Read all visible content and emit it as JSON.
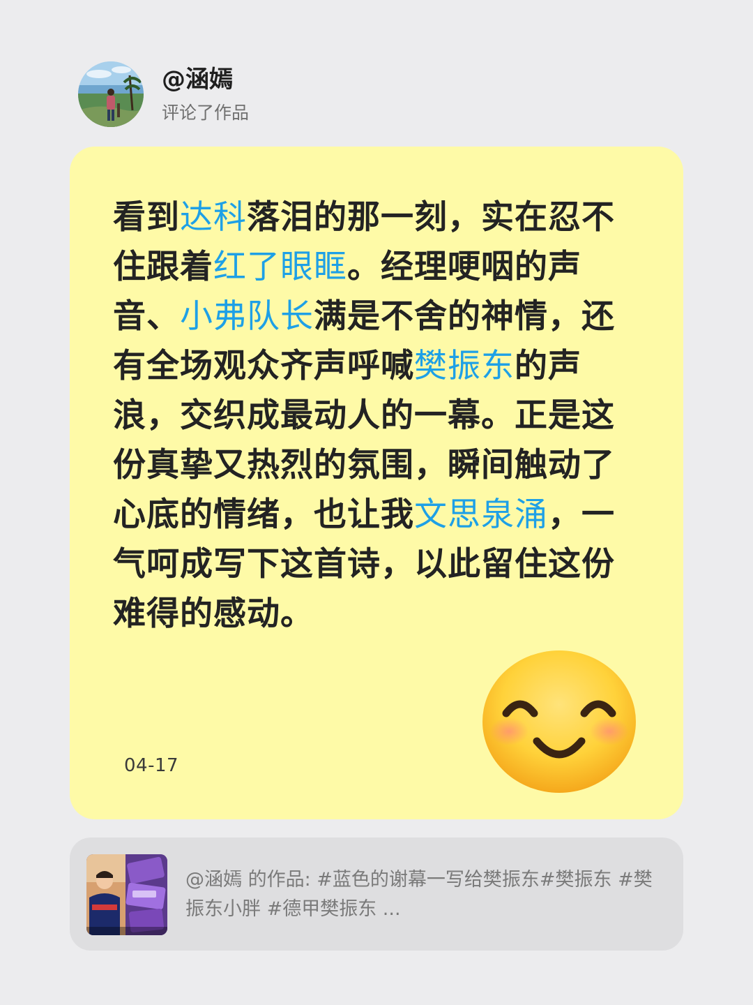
{
  "user": {
    "name": "@涵嫣",
    "action": "评论了作品"
  },
  "comment": {
    "segments": [
      {
        "text": "看到",
        "highlight": false
      },
      {
        "text": "达科",
        "highlight": true
      },
      {
        "text": "落泪的那一刻，实在忍不住跟着",
        "highlight": false
      },
      {
        "text": "红了眼眶",
        "highlight": true
      },
      {
        "text": "。经理哽咽的声音、",
        "highlight": false
      },
      {
        "text": "小弗队长",
        "highlight": true
      },
      {
        "text": "满是不舍的神情，还有全场观众齐声呼喊",
        "highlight": false
      },
      {
        "text": "樊振东",
        "highlight": true
      },
      {
        "text": "的声浪，交织成最动人的一幕。正是这份真挚又热烈的氛围，瞬间触动了心底的情绪，也让我",
        "highlight": false
      },
      {
        "text": "文思泉涌",
        "highlight": true
      },
      {
        "text": "，一气呵成写下这首诗，以此留住这份难得的感动。",
        "highlight": false
      }
    ],
    "date": "04-17",
    "emoji": "smiling-face-with-smiling-eyes"
  },
  "work": {
    "description": "@涵嫣 的作品: #蓝色的谢幕一写给樊振东#樊振东 #樊振东小胖 #德甲樊振东 ..."
  },
  "colors": {
    "background": "#ececee",
    "card_yellow": "#fefaa7",
    "highlight_blue": "#1ea0e6",
    "work_card": "#dedee0"
  }
}
